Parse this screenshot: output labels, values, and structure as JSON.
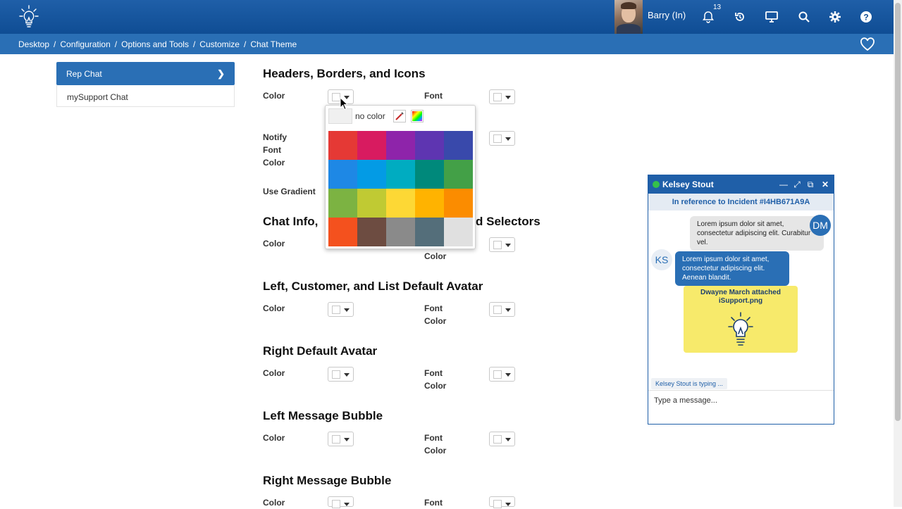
{
  "header": {
    "user_name": "Barry (In)",
    "notification_count": "13",
    "icons": [
      "lightbulb-logo-icon",
      "bell-icon",
      "history-icon",
      "monitor-icon",
      "search-icon",
      "gear-icon",
      "help-icon"
    ]
  },
  "breadcrumb": {
    "items": [
      "Desktop",
      "Configuration",
      "Options and Tools",
      "Customize",
      "Chat Theme"
    ],
    "separator": "/"
  },
  "sidebar": {
    "items": [
      {
        "label": "Rep Chat",
        "active": true
      },
      {
        "label": "mySupport Chat",
        "active": false
      }
    ]
  },
  "sections": {
    "s1": {
      "title": "Headers, Borders, and Icons",
      "color": "Color",
      "font": "Font",
      "notify_font_color": "Notify",
      "notify_font": "Font",
      "notify_color": "Color",
      "use_gradient": "Use Gradient"
    },
    "s2": {
      "title_left": "Chat Info,",
      "title_right": "d Selectors",
      "color": "Color",
      "color2": "Color"
    },
    "s3": {
      "title": "Left, Customer, and List Default Avatar",
      "color": "Color",
      "font": "Font",
      "color2": "Color"
    },
    "s4": {
      "title": "Right Default Avatar",
      "color": "Color",
      "font": "Font",
      "color2": "Color"
    },
    "s5": {
      "title": "Left Message Bubble",
      "color": "Color",
      "font": "Font",
      "color2": "Color"
    },
    "s6": {
      "title": "Right Message Bubble",
      "color": "Color",
      "font": "Font"
    }
  },
  "palette": {
    "no_color_label": "no color",
    "colors": [
      "#e53935",
      "#d81b60",
      "#8e24aa",
      "#5e35b1",
      "#3949ab",
      "#1e88e5",
      "#039be5",
      "#00acc1",
      "#00897b",
      "#43a047",
      "#7cb342",
      "#c0ca33",
      "#fdd835",
      "#ffb300",
      "#fb8c00",
      "#f4511e",
      "#6d4c41",
      "#8a8a8a",
      "#546e7a",
      "#e0e0e0"
    ]
  },
  "chat": {
    "name": "Kelsey Stout",
    "reference": "In reference to Incident #I4HB671A9A",
    "msg_right": "Lorem ipsum dolor sit amet, consectetur adipiscing elit. Curabitur vel.",
    "avatar_right": "DM",
    "msg_left": "Lorem ipsum dolor sit amet, consectetur adipiscing elit. Aenean blandit.",
    "avatar_left": "KS",
    "attachment_line1": "Dwayne March attached",
    "attachment_line2": "iSupport.png",
    "typing": "Kelsey Stout is typing ...",
    "input_placeholder": "Type a message..."
  },
  "colors": {
    "brand_dark": "#0f4d94",
    "brand": "#2a6fb5",
    "online": "#35c04a"
  }
}
